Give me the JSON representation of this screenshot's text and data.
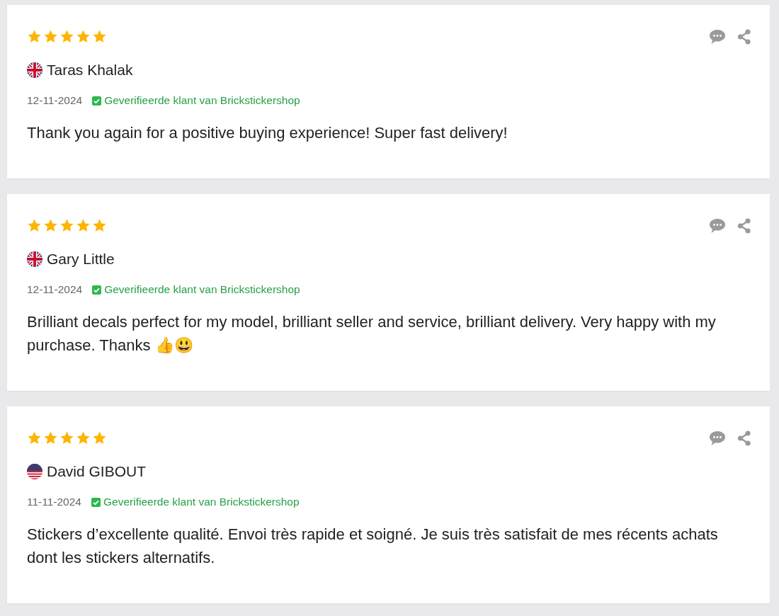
{
  "reviews": [
    {
      "stars": 5,
      "kind": "gb",
      "name": "Taras Khalak",
      "date": "12-11-2024",
      "verified": true,
      "badge": "Geverifieerde klant van Brickstickershop",
      "text": "Thank you again for a positive buying experience! Super fast delivery!"
    },
    {
      "stars": 5,
      "kind": "gb",
      "name": "Gary Little",
      "date": "12-11-2024",
      "verified": true,
      "badge": "Geverifieerde klant van Brickstickershop",
      "text": "Brilliant decals perfect for my model, brilliant seller and service, brilliant delivery. Very happy with my purchase. Thanks 👍😃"
    },
    {
      "stars": 5,
      "kind": "us",
      "name": "David GIBOUT",
      "date": "11-11-2024",
      "verified": true,
      "badge": "Geverifieerde klant van Brickstickershop",
      "text": "Stickers d’excellente qualité. Envoi très rapide et soigné. Je suis très satisfait de mes récents achats dont les stickers alternatifs."
    }
  ]
}
